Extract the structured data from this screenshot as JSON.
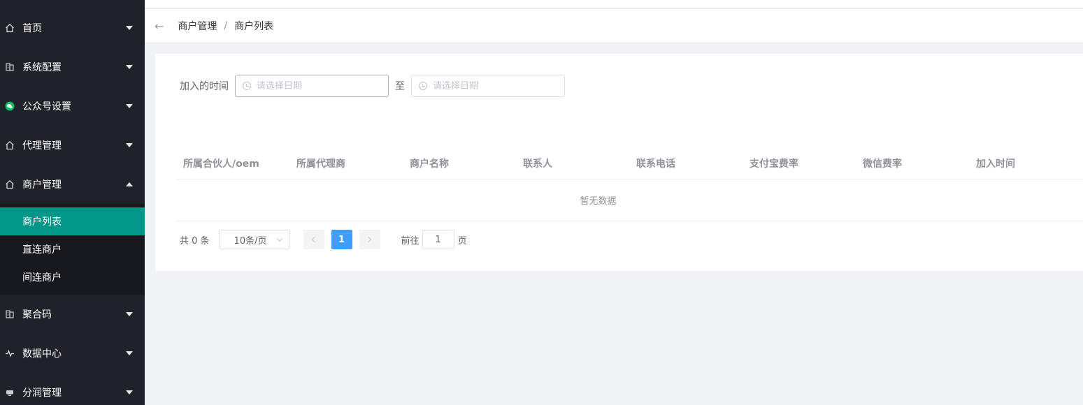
{
  "sidebar": {
    "items": [
      {
        "label": "首页",
        "icon": "home-icon"
      },
      {
        "label": "系统配置",
        "icon": "building-icon"
      },
      {
        "label": "公众号设置",
        "icon": "wechat-icon"
      },
      {
        "label": "代理管理",
        "icon": "home-icon"
      },
      {
        "label": "商户管理",
        "icon": "home-icon",
        "expanded": true
      },
      {
        "label": "聚合码",
        "icon": "building-icon"
      },
      {
        "label": "数据中心",
        "icon": "pulse-icon"
      },
      {
        "label": "分润管理",
        "icon": "monitor-icon"
      }
    ],
    "submenu": [
      {
        "label": "商户列表",
        "active": true
      },
      {
        "label": "直连商户"
      },
      {
        "label": "间连商户"
      }
    ]
  },
  "breadcrumb": {
    "back": "←",
    "items": [
      "商户管理",
      "商户列表"
    ],
    "separator": "/"
  },
  "filter": {
    "label": "加入的时间",
    "start_placeholder": "请选择日期",
    "to": "至",
    "end_placeholder": "请选择日期"
  },
  "table": {
    "columns": [
      "所属合伙人/oem",
      "所属代理商",
      "商户名称",
      "联系人",
      "联系电话",
      "支付宝费率",
      "微信费率",
      "加入时间"
    ],
    "empty_text": "暂无数据"
  },
  "pagination": {
    "total": "共 0 条",
    "page_size": "10条/页",
    "current_page": "1",
    "goto_label": "前往",
    "goto_value": "1",
    "goto_suffix": "页"
  },
  "colors": {
    "sidebar_bg": "#1f2229",
    "active_item": "#009688",
    "primary": "#409eff",
    "wechat_green": "#07c160"
  }
}
